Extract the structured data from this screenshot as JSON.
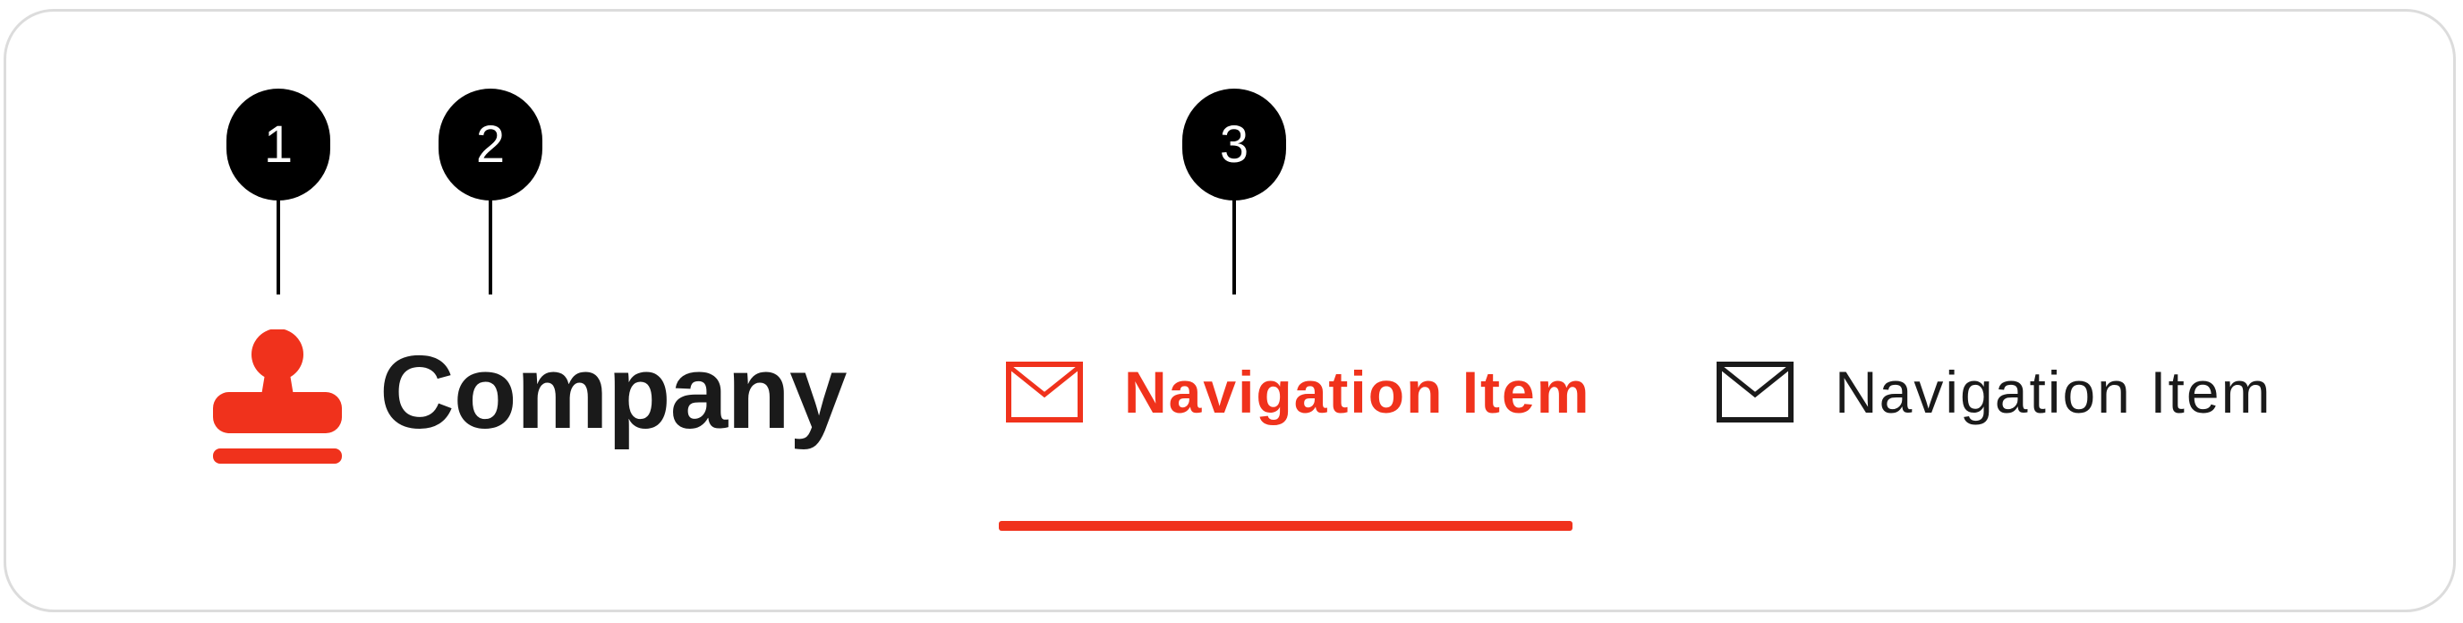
{
  "callouts": [
    "1",
    "2",
    "3"
  ],
  "brand": {
    "name": "Company",
    "icon": "stamp-icon",
    "color": "#f0321c"
  },
  "nav": {
    "active": {
      "label": "Navigation Item",
      "icon": "mail-icon",
      "color": "#f0321c"
    },
    "inactive": {
      "label": "Navigation Item",
      "icon": "mail-icon",
      "color": "#1a1a1a"
    }
  },
  "colors": {
    "accent": "#f0321c",
    "text": "#1a1a1a",
    "callout": "#000000",
    "border": "#dcdcdc"
  }
}
